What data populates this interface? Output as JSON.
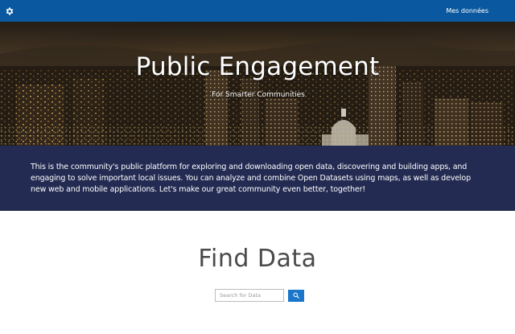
{
  "header": {
    "my_data_label": "Mes données",
    "settings_icon": "gear-icon",
    "bar_color": "#0a59a0"
  },
  "hero": {
    "title": "Public Engagement",
    "subtitle": "For Smarter Communities"
  },
  "intro": {
    "text": "This is the community's public platform for exploring and downloading open data, discovering and building apps, and engaging to solve important local issues. You can analyze and combine Open Datasets using maps, as well as develop new web and mobile applications. Let's make our great community even better, together!",
    "band_color": "#232b52"
  },
  "find_data": {
    "title": "Find Data",
    "search_placeholder": "Search for Data",
    "search_value": "",
    "search_icon": "search-icon",
    "button_color": "#1a76c9"
  }
}
